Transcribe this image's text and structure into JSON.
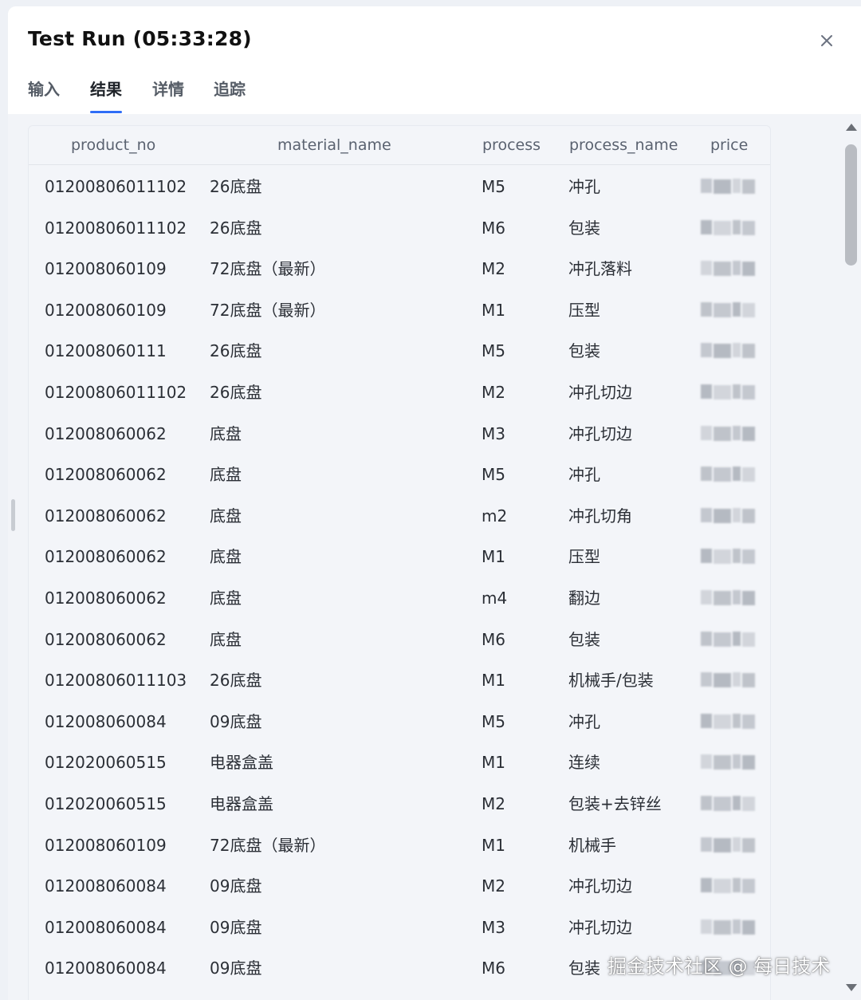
{
  "dialog": {
    "title": "Test Run (05:33:28)",
    "close_symbol": "×"
  },
  "tabs": [
    {
      "label": "输入",
      "active": false
    },
    {
      "label": "结果",
      "active": true
    },
    {
      "label": "详情",
      "active": false
    },
    {
      "label": "追踪",
      "active": false
    }
  ],
  "table": {
    "columns": [
      "product_no",
      "material_name",
      "process",
      "process_name",
      "price"
    ],
    "rows": [
      [
        "01200806011102",
        "26底盘",
        "M5",
        "冲孔"
      ],
      [
        "01200806011102",
        "26底盘",
        "M6",
        "包装"
      ],
      [
        "012008060109",
        "72底盘（最新）",
        "M2",
        "冲孔落料"
      ],
      [
        "012008060109",
        "72底盘（最新）",
        "M1",
        "压型"
      ],
      [
        "012008060111",
        "26底盘",
        "M5",
        "包装"
      ],
      [
        "01200806011102",
        "26底盘",
        "M2",
        "冲孔切边"
      ],
      [
        "012008060062",
        "底盘",
        "M3",
        "冲孔切边"
      ],
      [
        "012008060062",
        "底盘",
        "M5",
        "冲孔"
      ],
      [
        "012008060062",
        "底盘",
        "m2",
        "冲孔切角"
      ],
      [
        "012008060062",
        "底盘",
        "M1",
        "压型"
      ],
      [
        "012008060062",
        "底盘",
        "m4",
        "翻边"
      ],
      [
        "012008060062",
        "底盘",
        "M6",
        "包装"
      ],
      [
        "01200806011103",
        "26底盘",
        "M1",
        "机械手/包装"
      ],
      [
        "012008060084",
        "09底盘",
        "M5",
        "冲孔"
      ],
      [
        "012020060515",
        "电器盒盖",
        "M1",
        "连续"
      ],
      [
        "012020060515",
        "电器盒盖",
        "M2",
        "包装+去锌丝"
      ],
      [
        "012008060109",
        "72底盘（最新）",
        "M1",
        "机械手"
      ],
      [
        "012008060084",
        "09底盘",
        "M2",
        "冲孔切边"
      ],
      [
        "012008060084",
        "09底盘",
        "M3",
        "冲孔切边"
      ],
      [
        "012008060084",
        "09底盘",
        "M6",
        "包装"
      ]
    ]
  },
  "watermark": "掘金技术社区 @ 每日技术",
  "colors": {
    "accent": "#2f6df6",
    "panel": "#ffffff",
    "content_bg": "#f2f4f8"
  }
}
